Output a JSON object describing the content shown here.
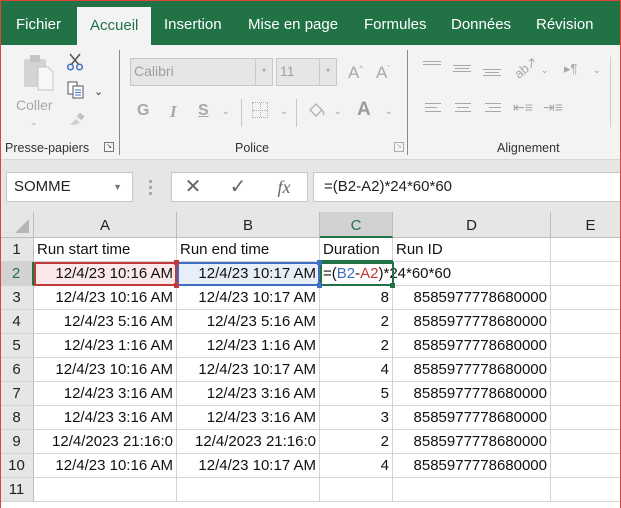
{
  "tabs": [
    {
      "label": "Fichier",
      "active": false
    },
    {
      "label": "Accueil",
      "active": true
    },
    {
      "label": "Insertion",
      "active": false
    },
    {
      "label": "Mise en page",
      "active": false
    },
    {
      "label": "Formules",
      "active": false
    },
    {
      "label": "Données",
      "active": false
    },
    {
      "label": "Révision",
      "active": false
    }
  ],
  "ribbon": {
    "clipboard": {
      "label": "Presse-papiers",
      "paste_label": "Coller",
      "icons": [
        "paste-icon",
        "cut-icon",
        "copy-icon",
        "format-painter-icon"
      ]
    },
    "font": {
      "label": "Police",
      "font_name": "Calibri",
      "font_size": "11",
      "bold": "G",
      "italic": "I",
      "underline": "S",
      "font_color_glyph": "A",
      "grow_glyph": "A",
      "shrink_glyph": "A"
    },
    "alignment": {
      "label": "Alignement"
    }
  },
  "formula_bar": {
    "name_box": "SOMME",
    "cancel_glyph": "✕",
    "enter_glyph": "✓",
    "fx_glyph": "fx",
    "formula": "=(B2-A2)*24*60*60"
  },
  "grid": {
    "columns": [
      "A",
      "B",
      "C",
      "D",
      "E"
    ],
    "selected_column": "C",
    "rows": [
      "1",
      "2",
      "3",
      "4",
      "5",
      "6",
      "7",
      "8",
      "9",
      "10",
      "11"
    ],
    "selected_row": "2",
    "headers": [
      "Run start time",
      "Run end time",
      "Duration",
      "Run ID"
    ],
    "edit_formula": {
      "prefix": "=(",
      "ref1": "B2",
      "minus": "-",
      "ref2": "A2",
      "suffix": ")*24*60*60"
    },
    "data": [
      {
        "start": "12/4/23 10:16 AM",
        "end": "12/4/23 10:17 AM",
        "duration": "",
        "run_id": ""
      },
      {
        "start": "12/4/23 10:16 AM",
        "end": "12/4/23 10:17 AM",
        "duration": "8",
        "run_id": "8585977778680000"
      },
      {
        "start": "12/4/23 5:16 AM",
        "end": "12/4/23 5:16 AM",
        "duration": "2",
        "run_id": "8585977778680000"
      },
      {
        "start": "12/4/23 1:16 AM",
        "end": "12/4/23 1:16 AM",
        "duration": "2",
        "run_id": "8585977778680000"
      },
      {
        "start": "12/4/23 10:16 AM",
        "end": "12/4/23 10:17 AM",
        "duration": "4",
        "run_id": "8585977778680000"
      },
      {
        "start": "12/4/23 3:16 AM",
        "end": "12/4/23 3:16 AM",
        "duration": "5",
        "run_id": "8585977778680000"
      },
      {
        "start": "12/4/23 3:16 AM",
        "end": "12/4/23 3:16 AM",
        "duration": "3",
        "run_id": "8585977778680000"
      },
      {
        "start": "12/4/2023  21:16:0",
        "end": "12/4/2023  21:16:0",
        "duration": "2",
        "run_id": "8585977778680000"
      },
      {
        "start": "12/4/23 10:16 AM",
        "end": "12/4/23 10:17 AM",
        "duration": "4",
        "run_id": "8585977778680000"
      }
    ]
  },
  "colors": {
    "accent": "#217346",
    "ref_red": "#c0393b",
    "ref_blue": "#3f6fc0"
  }
}
